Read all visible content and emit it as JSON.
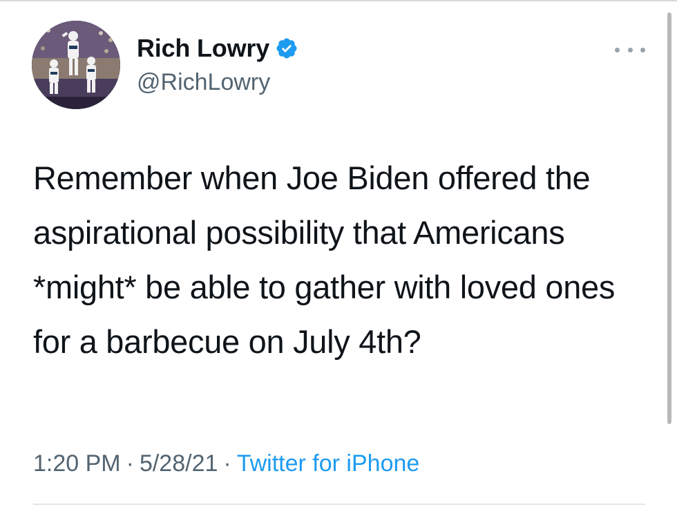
{
  "author": {
    "display_name": "Rich Lowry",
    "handle": "@RichLowry",
    "verified": true,
    "avatar_icon": "profile-photo-football-players"
  },
  "tweet": {
    "text": "Remember when Joe Biden offered the aspirational possibility that Americans *might* be able to gather with loved ones for a barbecue on July 4th?"
  },
  "meta": {
    "time": "1:20 PM",
    "separator": "·",
    "date": "5/28/21",
    "source": "Twitter for iPhone"
  },
  "colors": {
    "text": "#0f1419",
    "secondary": "#536471",
    "link": "#1d9bf0",
    "verified_badge": "#1d9bf0"
  },
  "icons": {
    "verified": "verified-badge-icon",
    "more": "more-options-icon"
  }
}
